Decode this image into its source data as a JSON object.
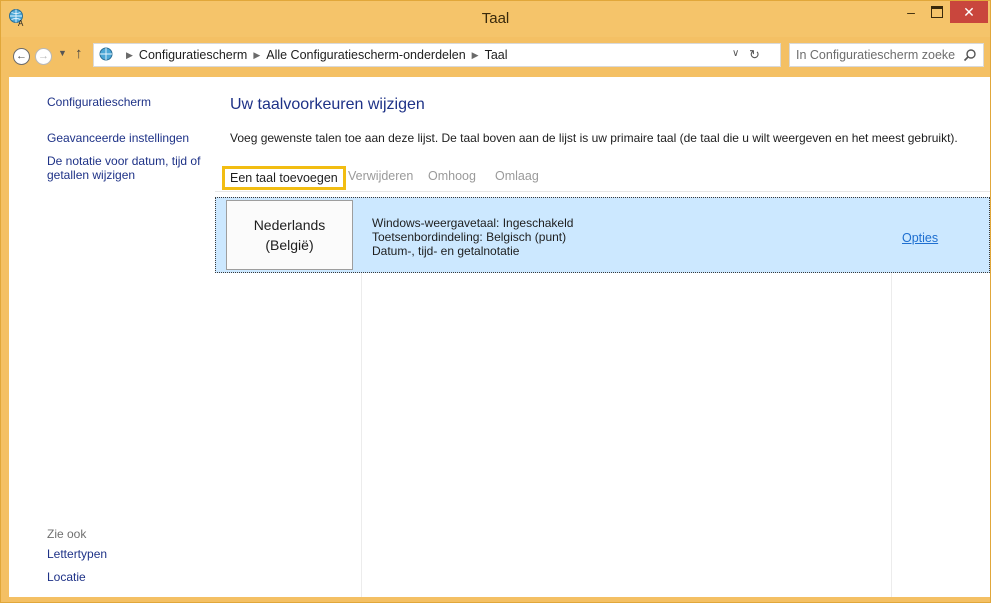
{
  "window": {
    "title": "Taal",
    "minimize": "–",
    "close": "✕"
  },
  "address": {
    "crumbs": [
      "Configuratiescherm",
      "Alle Configuratiescherm-onderdelen",
      "Taal"
    ],
    "search_placeholder": "In Configuratiescherm zoeken"
  },
  "sidebar": {
    "home": "Configuratiescherm",
    "advanced": "Geavanceerde instellingen",
    "format": "De notatie voor datum, tijd of getallen wijzigen",
    "see_also": "Zie ook",
    "fonts": "Lettertypen",
    "location": "Locatie"
  },
  "main": {
    "title": "Uw taalvoorkeuren wijzigen",
    "description": "Voeg gewenste talen toe aan deze lijst. De taal boven aan de lijst is uw primaire taal (de taal die u wilt weergeven en het meest gebruikt).",
    "toolbar": {
      "add": "Een taal toevoegen",
      "remove": "Verwijderen",
      "up": "Omhoog",
      "down": "Omlaag"
    },
    "languages": [
      {
        "name_line1": "Nederlands",
        "name_line2": "(België)",
        "info1": "Windows-weergavetaal: Ingeschakeld",
        "info2": "Toetsenbordindeling: Belgisch (punt)",
        "info3": "Datum-, tijd- en getalnotatie",
        "options": "Opties"
      }
    ]
  },
  "colors": {
    "titlebar": "#f5c46a",
    "link": "#1e3287",
    "selected_row": "#cce8ff",
    "highlight_border": "#f2bd12",
    "close_button": "#c9463d"
  }
}
